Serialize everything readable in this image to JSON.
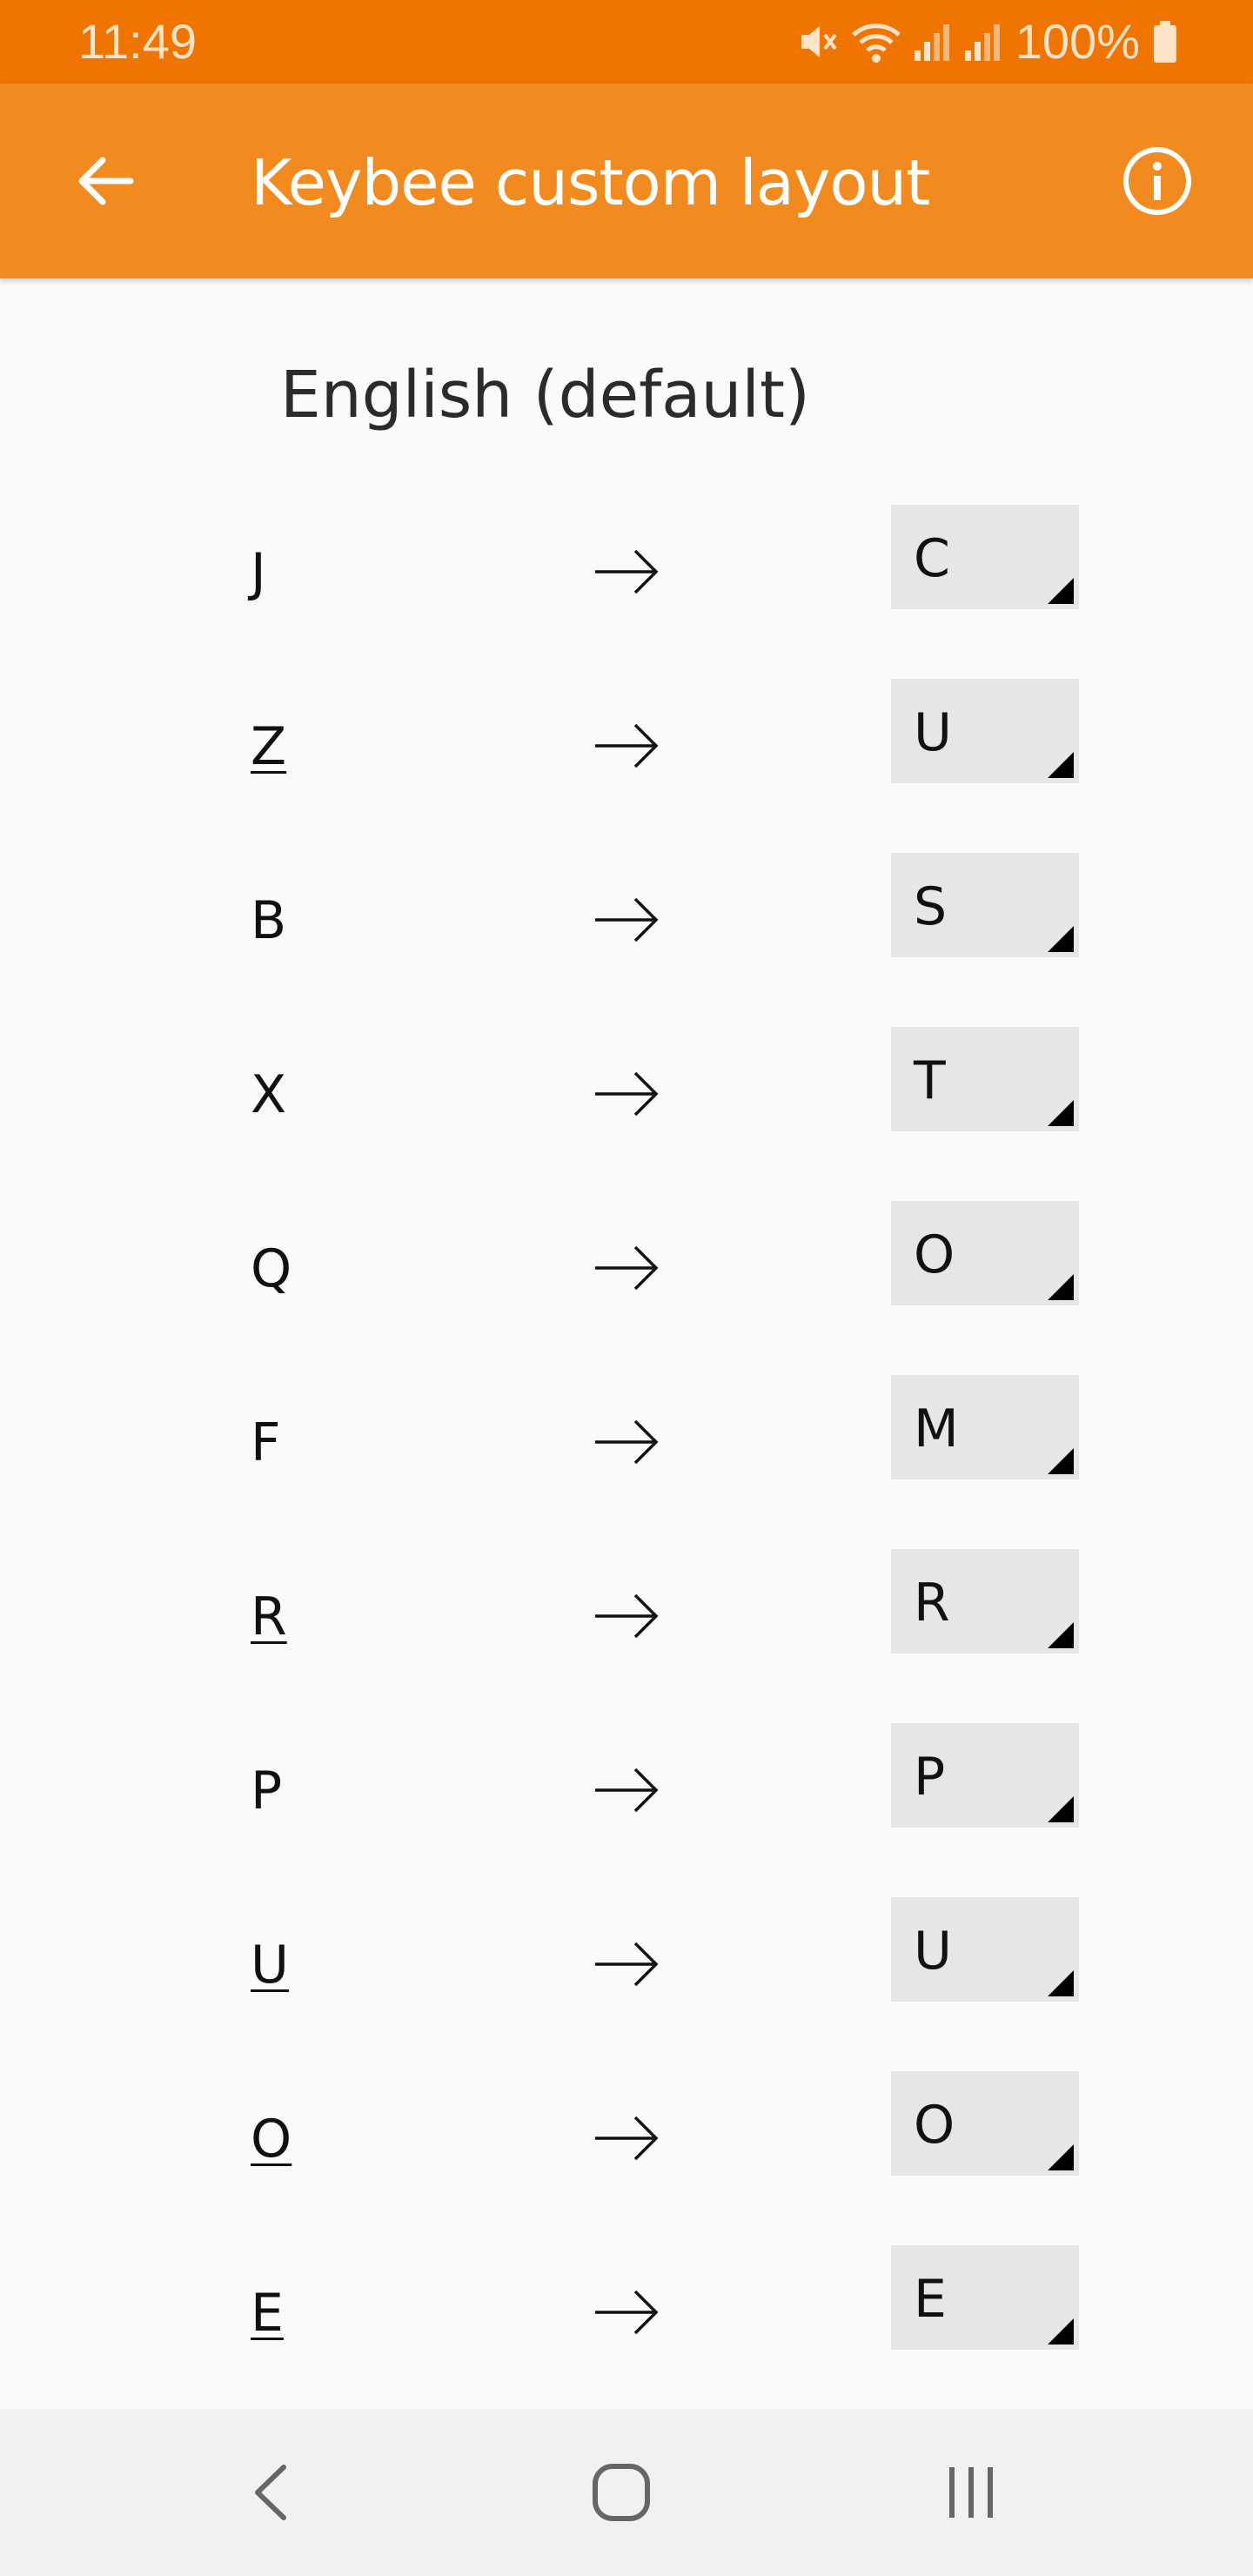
{
  "status_bar": {
    "time": "11:49",
    "battery": "100%",
    "icons": [
      "mute-icon",
      "wifi-icon",
      "signal-icon",
      "signal-icon",
      "battery-icon"
    ]
  },
  "app_bar": {
    "title": "Keybee custom layout",
    "color": "#f18a1f",
    "back_icon": "back-arrow-icon",
    "info_icon": "info-icon"
  },
  "section": {
    "title": "English (default)"
  },
  "mappings": [
    {
      "from": "J",
      "to": "C"
    },
    {
      "from": "Z",
      "to": "U"
    },
    {
      "from": "B",
      "to": "S"
    },
    {
      "from": "X",
      "to": "T"
    },
    {
      "from": "Q",
      "to": "O"
    },
    {
      "from": "F",
      "to": "M"
    },
    {
      "from": "R",
      "to": "R"
    },
    {
      "from": "P",
      "to": "P"
    },
    {
      "from": "U",
      "to": "U"
    },
    {
      "from": "O",
      "to": "O"
    },
    {
      "from": "E",
      "to": "E"
    }
  ],
  "nav_bar": {
    "icons": [
      "nav-back-icon",
      "nav-home-icon",
      "nav-recents-icon"
    ]
  }
}
